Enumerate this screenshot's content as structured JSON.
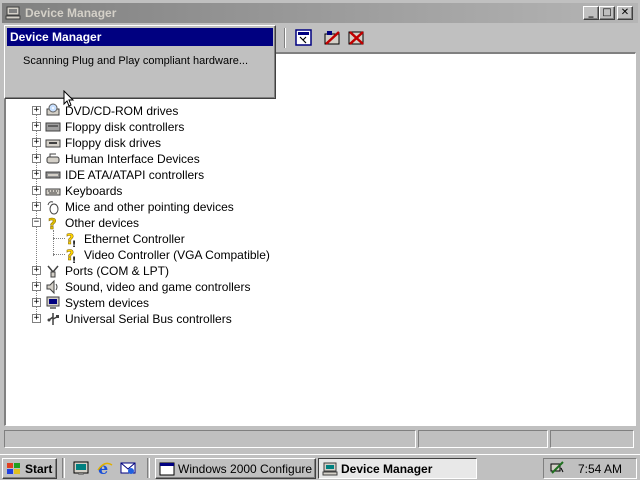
{
  "window": {
    "title": "Device Manager",
    "controls": {
      "minimize": "_",
      "maximize": "□",
      "close": "✕"
    }
  },
  "toolbar": {
    "buttons": [
      "properties-icon",
      "update-driver-icon",
      "uninstall-icon"
    ]
  },
  "dialog": {
    "title": "Device Manager",
    "message": "Scanning Plug and Play compliant hardware..."
  },
  "tree": {
    "items": [
      {
        "label": "DVD/CD-ROM drives",
        "icon": "cdrom-icon",
        "expanded": false
      },
      {
        "label": "Floppy disk controllers",
        "icon": "disk-controller-icon",
        "expanded": false
      },
      {
        "label": "Floppy disk drives",
        "icon": "floppy-drive-icon",
        "expanded": false
      },
      {
        "label": "Human Interface Devices",
        "icon": "hid-icon",
        "expanded": false
      },
      {
        "label": "IDE ATA/ATAPI controllers",
        "icon": "ide-controller-icon",
        "expanded": false
      },
      {
        "label": "Keyboards",
        "icon": "keyboard-icon",
        "expanded": false
      },
      {
        "label": "Mice and other pointing devices",
        "icon": "mouse-icon",
        "expanded": false
      },
      {
        "label": "Other devices",
        "icon": "unknown-device-icon",
        "expanded": true,
        "children": [
          {
            "label": "Ethernet Controller",
            "icon": "unknown-device-warning-icon"
          },
          {
            "label": "Video Controller (VGA Compatible)",
            "icon": "unknown-device-warning-icon"
          }
        ]
      },
      {
        "label": "Ports (COM & LPT)",
        "icon": "port-icon",
        "expanded": false
      },
      {
        "label": "Sound, video and game controllers",
        "icon": "sound-icon",
        "expanded": false
      },
      {
        "label": "System devices",
        "icon": "system-icon",
        "expanded": false
      },
      {
        "label": "Universal Serial Bus controllers",
        "icon": "usb-icon",
        "expanded": false
      }
    ]
  },
  "taskbar": {
    "start_label": "Start",
    "quick_launch": [
      "show-desktop-icon",
      "internet-explorer-icon",
      "outlook-express-icon"
    ],
    "tasks": [
      {
        "label": "Windows 2000 Configure ...",
        "active": false
      },
      {
        "label": "Device Manager",
        "active": true
      }
    ],
    "clock": "7:54 AM"
  },
  "colors": {
    "dialog_titlebar": "#000080",
    "inactive_titlebar": "#808080",
    "face": "#c0c0c0",
    "warning": "#ffd400"
  }
}
